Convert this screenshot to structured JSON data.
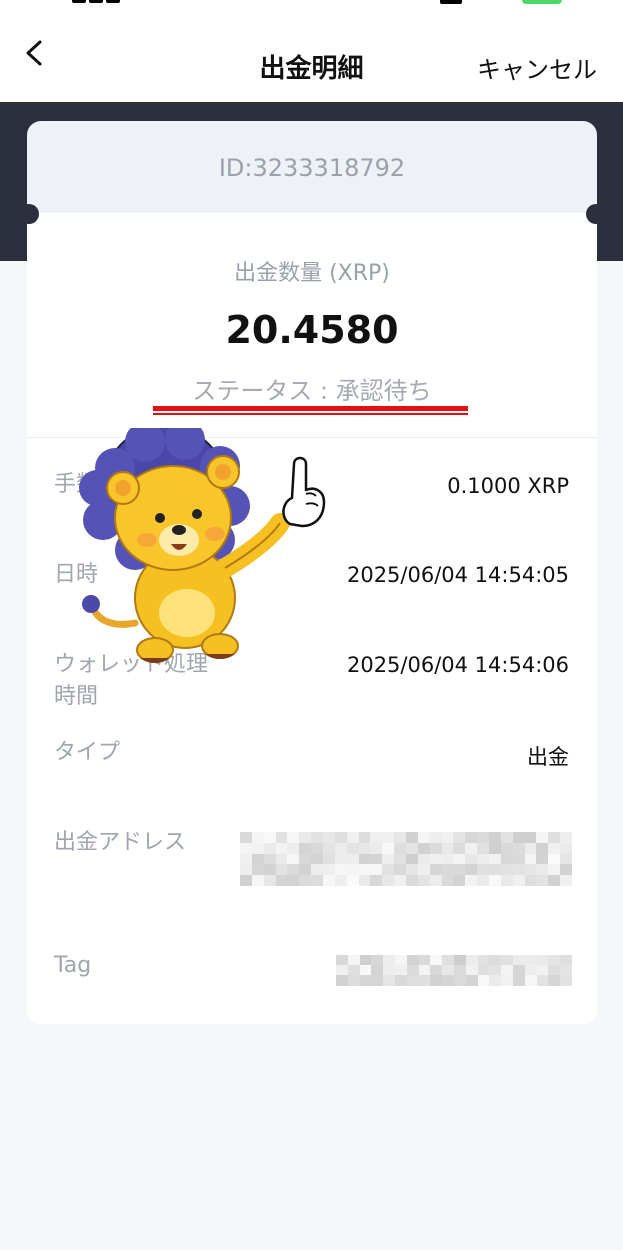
{
  "nav": {
    "title": "出金明細",
    "cancel_label": "キャンセル"
  },
  "card": {
    "id_text": "ID:3233318792",
    "amount_label": "出金数量 (XRP)",
    "amount_value": "20.4580",
    "status_text": "ステータス : 承認待ち"
  },
  "rows": [
    {
      "label": "手数料",
      "value": "0.1000 XRP"
    },
    {
      "label": "日時",
      "value": "2025/06/04 14:54:05"
    },
    {
      "label_line1": "ウォレット処理",
      "label_line2": "時間",
      "value": "2025/06/04 14:54:06"
    },
    {
      "label": "タイプ",
      "value": "出金"
    },
    {
      "label": "出金アドレス"
    },
    {
      "label": "Tag"
    }
  ],
  "colors": {
    "accent_underline": "#e31111",
    "header_band": "#2b2e3c"
  },
  "icons": {
    "back": "chevron-left-icon",
    "mascot": "lion-mascot"
  }
}
